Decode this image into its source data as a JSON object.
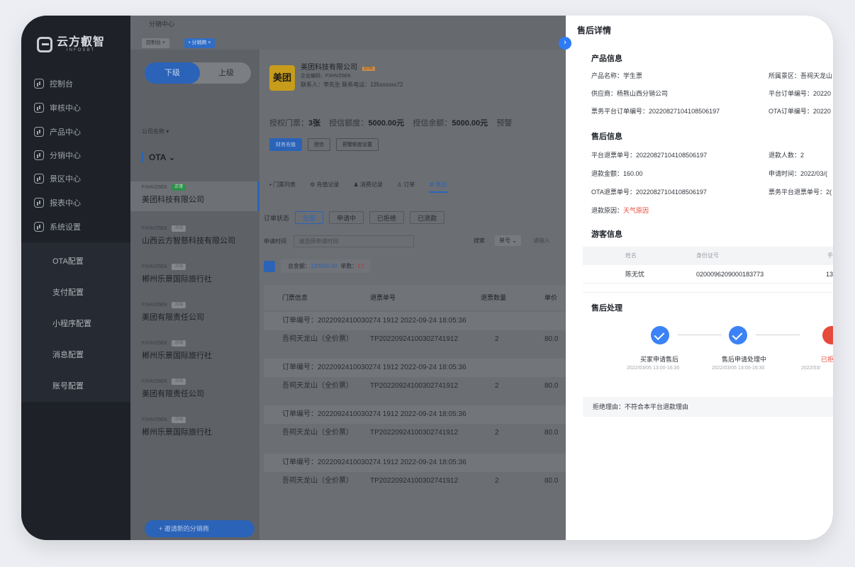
{
  "brand": {
    "name": "云方叡智",
    "sub": "INFOSBT"
  },
  "sidebar": {
    "items": [
      "控制台",
      "审核中心",
      "产品中心",
      "分销中心",
      "景区中心",
      "报表中心",
      "系统设置"
    ],
    "submenu": [
      "OTA配置",
      "支付配置",
      "小程序配置",
      "消息配置",
      "账号配置"
    ]
  },
  "breadcrumb": {
    "title": "分销中心",
    "tabs": [
      "控制台 ×",
      "• 分销商 ×"
    ]
  },
  "distributors": {
    "toggle": [
      "下级",
      "上级"
    ],
    "filter_label": "公司名称 ▾",
    "ota_select": "OTA ⌄",
    "list": [
      {
        "code": "FXHVZ6EK",
        "status": "正常",
        "name": "美团科技有限公司"
      },
      {
        "code": "FXHVZ6EK",
        "status": "冻结",
        "name": "山西云方智慈科技有限公司"
      },
      {
        "code": "FXHVZ6EK",
        "status": "冻结",
        "name": "郴州乐景国际旅行社"
      },
      {
        "code": "FXHVZ6EK",
        "status": "冻结",
        "name": "美团有限责任公司"
      },
      {
        "code": "FXHVZ6EK",
        "status": "冻结",
        "name": "郴州乐景国际旅行社"
      },
      {
        "code": "FXHVZ6EK",
        "status": "冻结",
        "name": "美团有限责任公司"
      },
      {
        "code": "FXHVZ6EK",
        "status": "冻结",
        "name": "郴州乐景国际旅行社"
      }
    ],
    "add_button": "+ 邀请新的分销商"
  },
  "company": {
    "logo": "美团",
    "name": "美团科技有限公司",
    "tag": "OTA",
    "code": "企业编码：FXHVZ6EK",
    "contact": "联系人：李先生   联系电话：135xxxxxx72",
    "stats": {
      "tickets_label": "授权门票：",
      "tickets": "3张",
      "credit_label": "授信额度：",
      "credit": "5000.00元",
      "balance_label": "授信余额：",
      "balance": "5000.00元",
      "warn_label": "预警"
    },
    "buttons": [
      "财务充值",
      "授信",
      "预警额度设置"
    ]
  },
  "tabs": [
    "▪ 门票列表",
    "⚙ 充值记录",
    "♟ 消费记录",
    "♙ 订单",
    "⚙ 售后"
  ],
  "filter": {
    "label": "订单状态",
    "chips": [
      "全部",
      "申请中",
      "已拒绝",
      "已退款"
    ]
  },
  "search": {
    "date_label": "申请时间",
    "date_placeholder": "请选择申请时间",
    "search_label": "搜索",
    "field": "单号 ⌄",
    "input_placeholder": "请输入"
  },
  "summary": {
    "total_label": "总金额：",
    "total": "120000.00",
    "count_label": "单数：",
    "count": "12"
  },
  "table": {
    "headers": [
      "门票信息",
      "退票单号",
      "退票数量",
      "单价"
    ],
    "orders": [
      {
        "head": "订单编号：2022092410030274 1912   2022-09-24 18:05:36",
        "ticket": "吾祠天龙山（全价票）",
        "refund_no": "TP20220924100302741912",
        "qty": "2",
        "price": "80.0"
      },
      {
        "head": "订单编号：2022092410030274 1912   2022-09-24 18:05:36",
        "ticket": "吾祠天龙山（全价票）",
        "refund_no": "TP20220924100302741912",
        "qty": "2",
        "price": "80.0"
      },
      {
        "head": "订单编号：2022092410030274 1912   2022-09-24 18:05:36",
        "ticket": "吾祠天龙山（全价票）",
        "refund_no": "TP20220924100302741912",
        "qty": "2",
        "price": "80.0"
      },
      {
        "head": "订单编号：2022092410030274 1912   2022-09-24 18:05:36",
        "ticket": "吾祠天龙山（全价票）",
        "refund_no": "TP20220924100302741912",
        "qty": "2",
        "price": "80.0"
      }
    ]
  },
  "drawer": {
    "title": "售后详情",
    "product_section": "产品信息",
    "product": {
      "name": "产品名称：学生票",
      "area": "所属景区：吾祠天龙山",
      "supplier": "供应商：杨熊山西分销公司",
      "platform_order": "平台订单编号：20220",
      "ticket_order": "票务平台订单编号：20220827104108506197",
      "ota_order": "OTA订单编号：20220"
    },
    "after_section": "售后信息",
    "after": {
      "refund_no": "平台退票单号：20220827104108506197",
      "people": "退款人数：2",
      "amount": "退款金额：160.00",
      "apply_time": "申请时间：2022/03/(",
      "ota_refund": "OTA退票单号：20220827104108506197",
      "ticket_refund": "票务平台退票单号：2(",
      "reason_label": "退款原因：",
      "reason": "天气原因"
    },
    "visitor_section": "游客信息",
    "visitor": {
      "headers": [
        "姓名",
        "身份证号",
        "手"
      ],
      "name": "陈无忧",
      "id": "0200096209000183773",
      "phone": "13"
    },
    "process_section": "售后处理",
    "steps": [
      {
        "label": "买家申请售后",
        "time": "2022/03/05 13:00-16:30"
      },
      {
        "label": "售后申请处理中",
        "time": "2022/03/05 13:00-16:30"
      },
      {
        "label": "已拒",
        "time": "2022/03/"
      }
    ],
    "reject": "拒绝理由：不符合本平台退款理由",
    "collapse_icon": "›"
  }
}
